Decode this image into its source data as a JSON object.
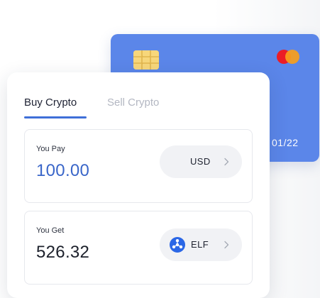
{
  "card": {
    "expiry": "01/22",
    "chip_icon": "card-chip-icon",
    "brand_icon": "mastercard-icon",
    "color": "#5b86e9"
  },
  "tabs": {
    "buy_label": "Buy Crypto",
    "sell_label": "Sell Crypto",
    "active": "Buy Crypto",
    "accent_color": "#3f6fd8"
  },
  "pay": {
    "label": "You Pay",
    "amount": "100.00",
    "currency": "USD",
    "amount_color": "#3a66c9"
  },
  "get": {
    "label": "You Get",
    "amount": "526.32",
    "currency": "ELF",
    "currency_icon": "elf-token-icon"
  }
}
